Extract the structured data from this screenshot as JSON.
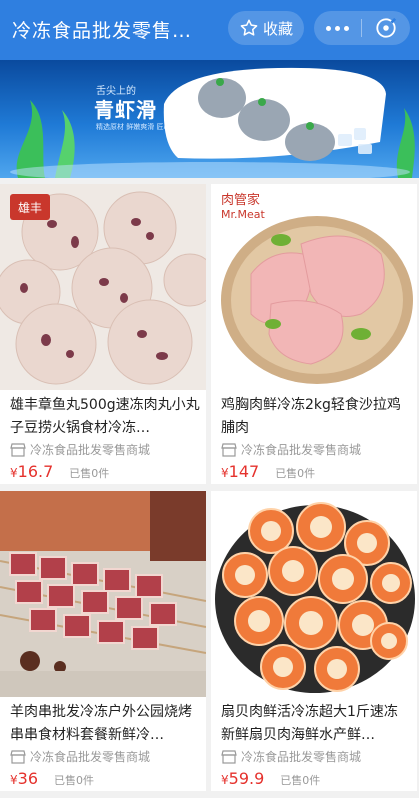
{
  "header": {
    "title": "冷冻食品批发零售…",
    "favorite_label": "收藏"
  },
  "banner": {
    "subtitle": "舌尖上的",
    "title": "青虾滑",
    "tags": "精选原材  鲜嫩爽滑  匠心品质"
  },
  "products": [
    {
      "name": "雄丰章鱼丸500g速冻肉丸小丸子豆捞火锅食材冷冻…",
      "shop": "冷冻食品批发零售商城",
      "price_symbol": "¥",
      "price": "16.7",
      "sold": "已售0件",
      "brand": "雄丰"
    },
    {
      "name": "鸡胸肉鲜冷冻2kg轻食沙拉鸡脯肉",
      "shop": "冷冻食品批发零售商城",
      "price_symbol": "¥",
      "price": "147",
      "sold": "已售0件",
      "brand": "肉管家 Mr.Meat"
    },
    {
      "name": "羊肉串批发冷冻户外公园烧烤串串食材料套餐新鲜冷…",
      "shop": "冷冻食品批发零售商城",
      "price_symbol": "¥",
      "price": "36",
      "sold": "已售0件"
    },
    {
      "name": "扇贝肉鲜活冷冻超大1斤速冻新鲜扇贝肉海鲜水产鲜…",
      "shop": "冷冻食品批发零售商城",
      "price_symbol": "¥",
      "price": "59.9",
      "sold": "已售0件"
    }
  ],
  "colors": {
    "header_bg": "#2f7fe0",
    "price": "#e5322d"
  }
}
